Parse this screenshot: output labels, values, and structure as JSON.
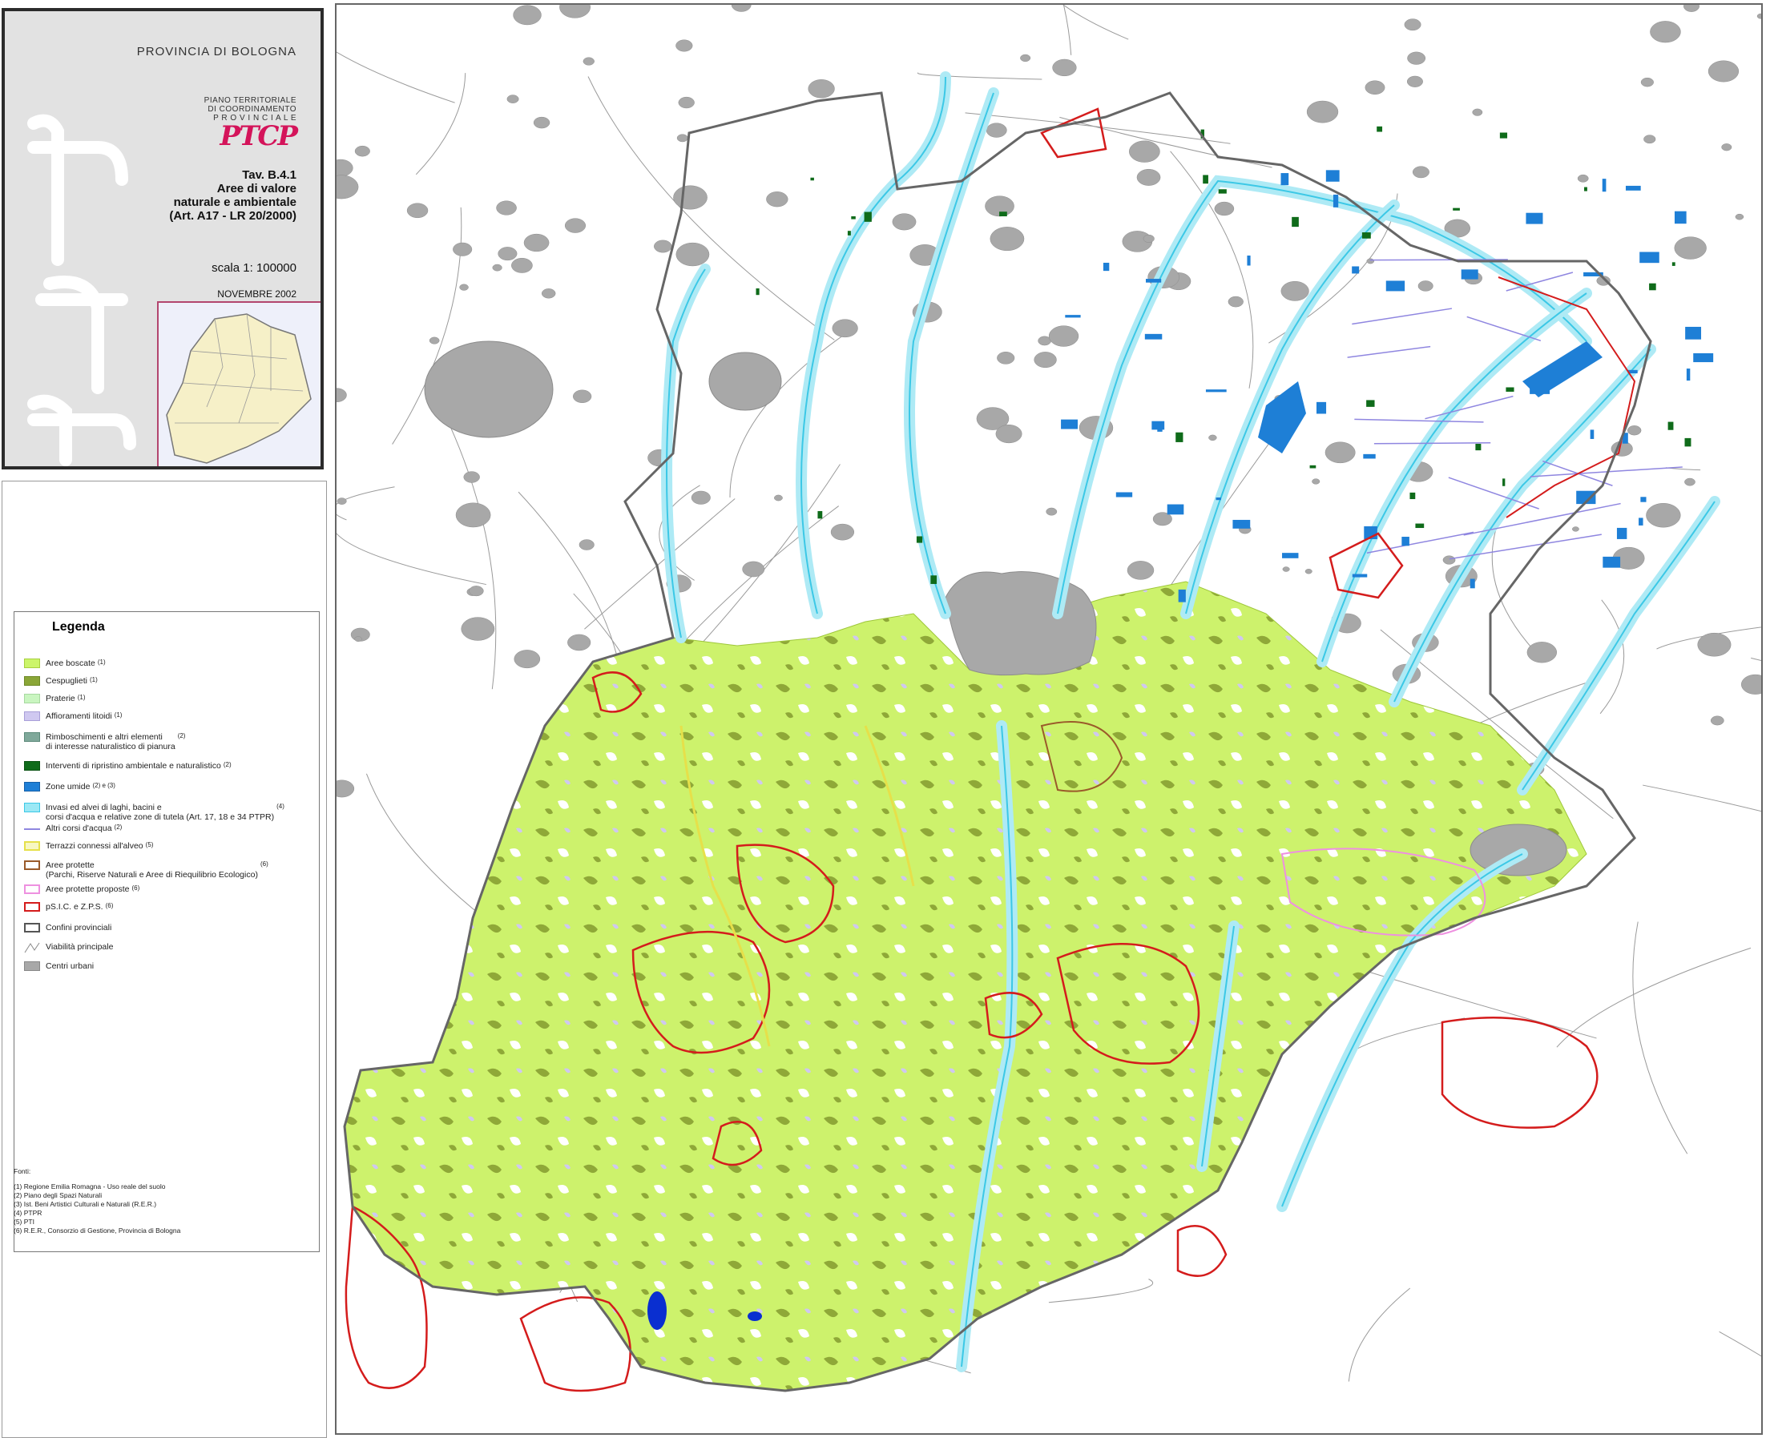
{
  "header": {
    "province": "PROVINCIA DI BOLOGNA",
    "plan_lines": [
      "PIANO TERRITORIALE",
      "DI COORDINAMENTO",
      "P R O V I N C I A L E"
    ],
    "logo_text": "PTCP",
    "tav_lines": [
      "Tav. B.4.1",
      "Aree di valore",
      "naturale e ambientale",
      "(Art. A17 - LR 20/2000)"
    ],
    "scale": "scala 1: 100000",
    "date": "NOVEMBRE 2002"
  },
  "legend": {
    "title": "Legenda",
    "items": [
      {
        "label": "Aree boscate",
        "note": "(1)",
        "fill": "#ccf56a",
        "stroke": "#a8d040",
        "style": "fill"
      },
      {
        "label": "Cespuglieti",
        "note": "(1)",
        "fill": "#8aa637",
        "stroke": "#6e8a28",
        "style": "fill"
      },
      {
        "label": "Praterie",
        "note": "(1)",
        "fill": "#c9f5c0",
        "stroke": "#a8d8a0",
        "style": "fill"
      },
      {
        "label": "Affioramenti litoidi",
        "note": "(1)",
        "fill": "#cfc8f0",
        "stroke": "#a99fd8",
        "style": "fill"
      },
      {
        "label": "Rimboschimenti e altri elementi\ndi interesse naturalistico di pianura",
        "note": "(2)",
        "fill": "#7fa89a",
        "stroke": "#5c8a7a",
        "style": "fill"
      },
      {
        "label": "Interventi di ripristino ambientale e naturalistico",
        "note": "(2)",
        "fill": "#0f6b1a",
        "stroke": "#0a5212",
        "style": "fill"
      },
      {
        "label": "Zone umide",
        "note": "(2) e (3)",
        "fill": "#1e7fd6",
        "stroke": "#155fa8",
        "style": "fill"
      },
      {
        "label": "Invasi ed alvei di laghi, bacini e\ncorsi d'acqua e relative zone di tutela (Art. 17, 18 e 34 PTPR)",
        "note": "(4)",
        "fill": "#9be8f5",
        "stroke": "#3cc8e6",
        "style": "fill"
      },
      {
        "label": "Altri corsi d'acqua",
        "note": "(2)",
        "fill": "none",
        "stroke": "#8f86e0",
        "style": "line"
      },
      {
        "label": "Terrazzi connessi all'alveo",
        "note": "(5)",
        "fill": "#f7f7c2",
        "stroke": "#e6e04a",
        "style": "outline"
      },
      {
        "label": "Aree protette\n(Parchi, Riserve Naturali e Aree di Riequilibrio Ecologico)",
        "note": "(6)",
        "fill": "none",
        "stroke": "#9a5a2a",
        "style": "outline"
      },
      {
        "label": "Aree protette proposte",
        "note": "(6)",
        "fill": "none",
        "stroke": "#ee90e0",
        "style": "outline"
      },
      {
        "label": "pS.I.C. e Z.P.S.",
        "note": "(6)",
        "fill": "none",
        "stroke": "#d41c1c",
        "style": "outline"
      },
      {
        "label": "Confini provinciali",
        "note": "",
        "fill": "none",
        "stroke": "#555555",
        "style": "outline"
      },
      {
        "label": "Viabilità principale",
        "note": "",
        "fill": "none",
        "stroke": "#999999",
        "style": "road"
      },
      {
        "label": "Centri urbani",
        "note": "",
        "fill": "#a8a8a8",
        "stroke": "#888888",
        "style": "fill"
      }
    ]
  },
  "sources": {
    "title": "Fonti:",
    "lines": [
      "(1) Regione Emilia Romagna - Uso  reale del suolo",
      "(2) Piano degli Spazi Naturali",
      "(3) Ist. Beni Artistici Culturali e Naturali (R.E.R.)",
      "(4) PTPR",
      "(5) PTI",
      "(6) R.E.R., Consorzio di Gestione, Provincia di Bologna"
    ]
  }
}
